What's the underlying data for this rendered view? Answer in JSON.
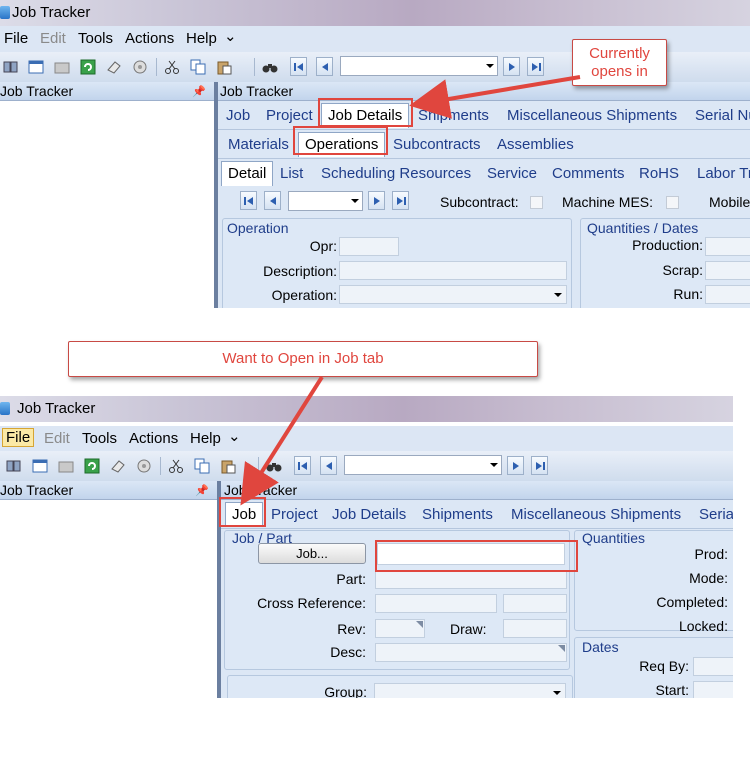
{
  "window": {
    "title": "Job Tracker"
  },
  "menu": [
    "File",
    "Edit",
    "Tools",
    "Actions",
    "Help"
  ],
  "left_pane": {
    "title": "Job Tracker",
    "pin_icon": "pin-icon"
  },
  "right_pane": {
    "title": "Job Tracker"
  },
  "screen1": {
    "main_tabs": [
      "Job",
      "Project",
      "Job Details",
      "Shipments",
      "Miscellaneous Shipments",
      "Serial Nu"
    ],
    "sub_tabs": [
      "Materials",
      "Operations",
      "Subcontracts",
      "Assemblies"
    ],
    "detail_tabs": [
      "Detail",
      "List",
      "Scheduling Resources",
      "Service",
      "Comments",
      "RoHS",
      "Labor Tr"
    ],
    "subcontract_label": "Subcontract:",
    "machine_label": "Machine MES:",
    "mobile_label": "Mobile",
    "operation_group": {
      "title": "Operation",
      "opr_label": "Opr:",
      "description_label": "Description:",
      "operation_label": "Operation:"
    },
    "quantities_group": {
      "title": "Quantities / Dates",
      "production_label": "Production:",
      "scrap_label": "Scrap:",
      "run_label": "Run:"
    }
  },
  "screen2": {
    "main_tabs": [
      "Job",
      "Project",
      "Job Details",
      "Shipments",
      "Miscellaneous Shipments",
      "Seria"
    ],
    "job_part_group": {
      "title": "Job / Part",
      "job_button": "Job...",
      "part_label": "Part:",
      "cross_reference_label": "Cross Reference:",
      "rev_label": "Rev:",
      "draw_label": "Draw:",
      "desc_label": "Desc:",
      "group_label": "Group:"
    },
    "quantities_group": {
      "title": "Quantities",
      "prod_label": "Prod:",
      "mode_label": "Mode:",
      "completed_label": "Completed:",
      "locked_label": "Locked:"
    },
    "dates_group": {
      "title": "Dates",
      "req_by_label": "Req By:",
      "start_label": "Start:"
    }
  },
  "annotations": {
    "currently_opens_in": "Currently\nopens in",
    "want_to_open": "Want to Open in Job tab"
  },
  "colors": {
    "highlight": "#e0463e",
    "tab_text": "#1f3d8a",
    "panel": "#dce7f5"
  }
}
